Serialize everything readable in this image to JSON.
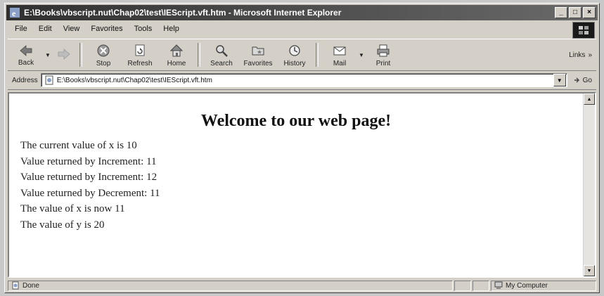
{
  "window": {
    "title": "E:\\Books\\vbscript.nut\\Chap02\\test\\IEScript.vft.htm - Microsoft Internet Explorer",
    "controls": [
      "_",
      "□",
      "×"
    ]
  },
  "menu": [
    "File",
    "Edit",
    "View",
    "Favorites",
    "Tools",
    "Help"
  ],
  "toolbar": {
    "back": "Back",
    "stop": "Stop",
    "refresh": "Refresh",
    "home": "Home",
    "search": "Search",
    "favorites": "Favorites",
    "history": "History",
    "mail": "Mail",
    "print": "Print",
    "links": "Links",
    "more": "»"
  },
  "address": {
    "label": "Address",
    "value": "E:\\Books\\vbscript.nut\\Chap02\\test\\IEScript.vft.htm",
    "go": "Go"
  },
  "page": {
    "heading": "Welcome to our web page!",
    "lines": [
      "The current value of x is 10",
      "Value returned by Increment: 11",
      "Value returned by Increment: 12",
      "Value returned by Decrement: 11",
      "The value of x is now 11",
      "The value of y is 20"
    ]
  },
  "status": {
    "text": "Done",
    "zone": "My Computer"
  },
  "colors": {
    "title_bar": "#303030",
    "chrome": "#d4d0c8",
    "content_bg": "#ffffff"
  }
}
